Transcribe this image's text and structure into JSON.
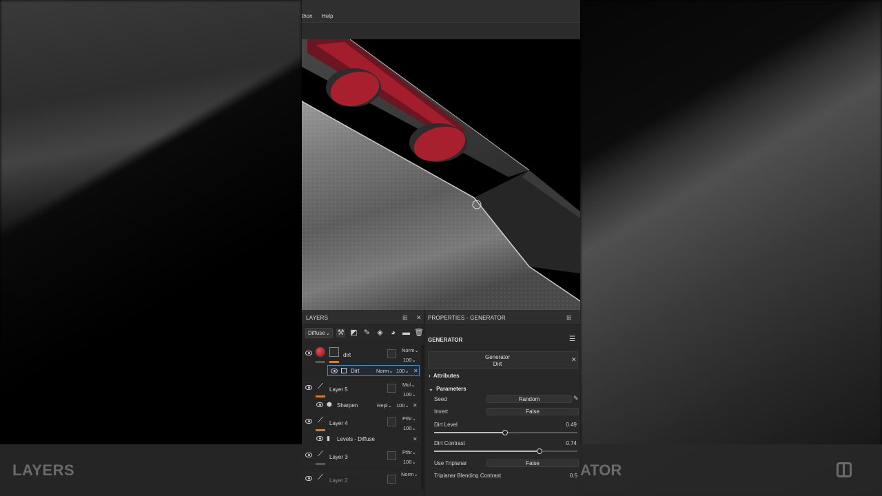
{
  "menu": {
    "items": [
      "thon",
      "Help"
    ]
  },
  "background": {
    "left_label": "LAYERS",
    "right_label": "ATOR"
  },
  "layers_panel": {
    "title": "LAYERS",
    "channel": "Diffuse",
    "layers": [
      {
        "name": "dirt",
        "blend": "Norm",
        "opacity": "100",
        "effect": {
          "name": "Dirt",
          "blend": "Norm",
          "opacity": "100"
        }
      },
      {
        "name": "Layer 5",
        "blend": "Mul",
        "opacity": "100",
        "effect": {
          "name": "Sharpen",
          "blend": "Repl",
          "opacity": "100"
        }
      },
      {
        "name": "Layer 4",
        "blend": "Pthr",
        "opacity": "100",
        "effect": {
          "name": "Levels - Diffuse"
        }
      },
      {
        "name": "Layer 3",
        "blend": "Pthr",
        "opacity": "100"
      },
      {
        "name": "Layer 2",
        "blend": "Norm"
      }
    ]
  },
  "properties_panel": {
    "title": "PROPERTIES - GENERATOR",
    "section_title": "GENERATOR",
    "generator": {
      "type": "Generator",
      "name": "Dirt"
    },
    "attributes_label": "Attributes",
    "parameters_label": "Parameters",
    "params": {
      "seed": {
        "label": "Seed",
        "value": "Random"
      },
      "invert": {
        "label": "Invert",
        "value": "False"
      },
      "dirt_level": {
        "label": "Dirt Level",
        "value": "0.49"
      },
      "dirt_contrast": {
        "label": "Dirt Contrast",
        "value": "0.74"
      },
      "use_triplanar": {
        "label": "Use Triplanar",
        "value": "False"
      },
      "triplanar_blend": {
        "label": "Triplanar Blending Contrast",
        "value": "0.5"
      }
    }
  },
  "colors": {
    "accent_orange": "#e07a22",
    "selected_border": "#3d8bd1",
    "paint_red": "#a31d2c"
  }
}
